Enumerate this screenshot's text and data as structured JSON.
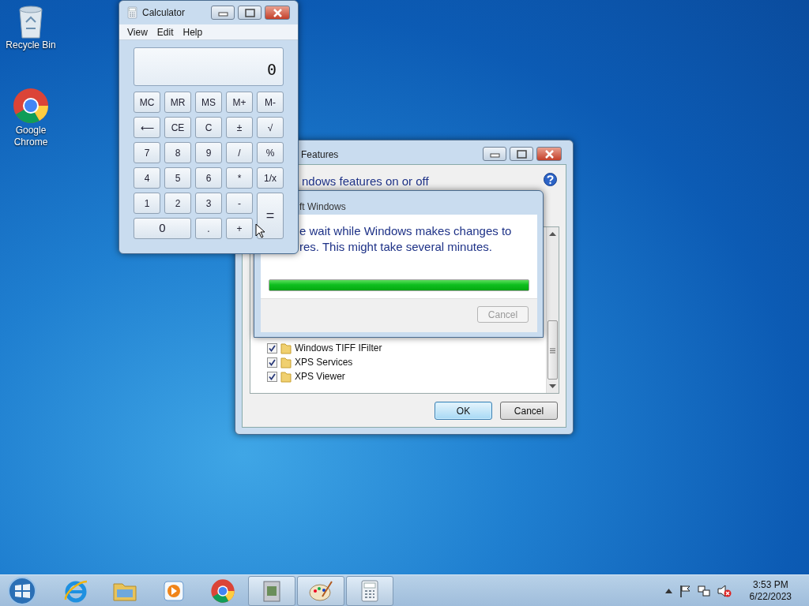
{
  "desktop_icons": [
    {
      "label": "Recycle Bin",
      "kind": "bin"
    },
    {
      "label": "Google Chrome",
      "kind": "browser"
    }
  ],
  "calculator": {
    "title": "Calculator",
    "menu": [
      "View",
      "Edit",
      "Help"
    ],
    "display": "0",
    "keys": [
      {
        "label": "MC",
        "kind": "key"
      },
      {
        "label": "MR",
        "kind": "key"
      },
      {
        "label": "MS",
        "kind": "key"
      },
      {
        "label": "M+",
        "kind": "key"
      },
      {
        "label": "M-",
        "kind": "key"
      },
      {
        "label": "⟵",
        "kind": "key"
      },
      {
        "label": "CE",
        "kind": "key"
      },
      {
        "label": "C",
        "kind": "key"
      },
      {
        "label": "±",
        "kind": "key"
      },
      {
        "label": "√",
        "kind": "key"
      },
      {
        "label": "7",
        "kind": "key"
      },
      {
        "label": "8",
        "kind": "key"
      },
      {
        "label": "9",
        "kind": "key"
      },
      {
        "label": "/",
        "kind": "key"
      },
      {
        "label": "%",
        "kind": "key"
      },
      {
        "label": "4",
        "kind": "key"
      },
      {
        "label": "5",
        "kind": "key"
      },
      {
        "label": "6",
        "kind": "key"
      },
      {
        "label": "*",
        "kind": "key"
      },
      {
        "label": "1/x",
        "kind": "key"
      },
      {
        "label": "1",
        "kind": "key"
      },
      {
        "label": "2",
        "kind": "key"
      },
      {
        "label": "3",
        "kind": "key"
      },
      {
        "label": "-",
        "kind": "key"
      },
      {
        "label": "=",
        "kind": "tall"
      },
      {
        "label": "0",
        "kind": "wide"
      },
      {
        "label": ".",
        "kind": "key"
      },
      {
        "label": "+",
        "kind": "key"
      }
    ]
  },
  "features_window": {
    "title": "Features",
    "heading": "ndows features on or off",
    "items": [
      {
        "label": "Windows TIFF IFilter",
        "checked": true
      },
      {
        "label": "XPS Services",
        "checked": true
      },
      {
        "label": "XPS Viewer",
        "checked": true
      }
    ],
    "buttons": [
      {
        "label": "OK",
        "default": true
      },
      {
        "label": "Cancel",
        "default": false
      }
    ]
  },
  "progress_dialog": {
    "title": "ft Windows",
    "message_lines": [
      "e wait while Windows makes changes to",
      "res. This might take several minutes."
    ],
    "progress": {
      "level": 1
    },
    "button": {
      "label": "Cancel",
      "disabled": true
    }
  },
  "taskbar": {
    "pinned": [
      {
        "kind": "ie"
      },
      {
        "kind": "folder"
      },
      {
        "kind": "media"
      },
      {
        "kind": "browser"
      }
    ],
    "running": [
      {
        "kind": "installer"
      },
      {
        "kind": "paint"
      },
      {
        "kind": "calc"
      }
    ],
    "clock": {
      "time": "3:53 PM",
      "date": "6/22/2023"
    }
  }
}
